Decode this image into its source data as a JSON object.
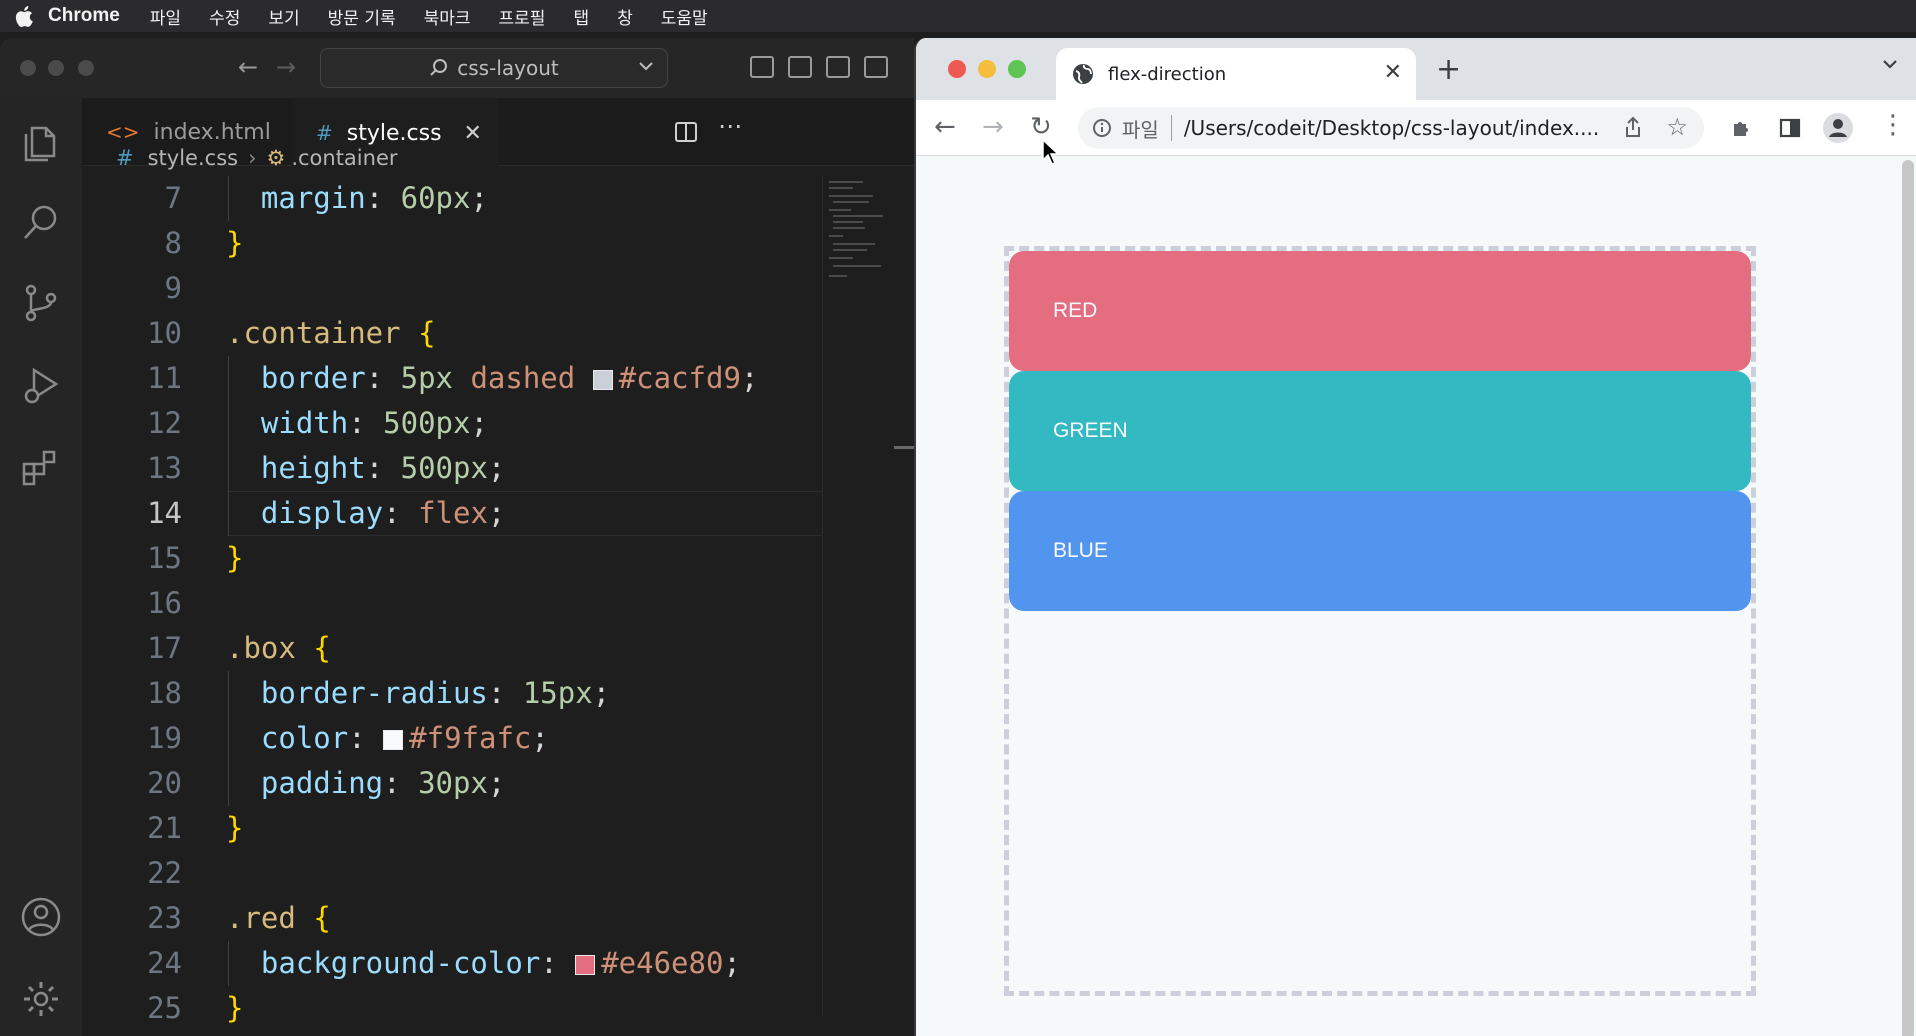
{
  "menubar": {
    "app_name": "Chrome",
    "items": [
      "파일",
      "수정",
      "보기",
      "방문 기록",
      "북마크",
      "프로필",
      "탭",
      "창",
      "도움말"
    ]
  },
  "vscode": {
    "search_text": "css-layout",
    "tabs": [
      {
        "icon": "<>",
        "label": "index.html",
        "active": false
      },
      {
        "icon": "#",
        "label": "style.css",
        "active": true
      }
    ],
    "breadcrumb": {
      "file": "style.css",
      "symbol": ".container"
    },
    "lines": [
      {
        "n": "7",
        "active": false,
        "tokens": [
          [
            "  ",
            "punc"
          ],
          [
            "margin",
            "prop"
          ],
          [
            ": ",
            "punc"
          ],
          [
            "60px",
            "num"
          ],
          [
            ";",
            "punc"
          ]
        ]
      },
      {
        "n": "8",
        "active": false,
        "tokens": [
          [
            "}",
            "brace"
          ]
        ]
      },
      {
        "n": "9",
        "active": false,
        "tokens": []
      },
      {
        "n": "10",
        "active": false,
        "tokens": [
          [
            ".container",
            "sel"
          ],
          [
            " ",
            "punc"
          ],
          [
            "{",
            "brace"
          ]
        ]
      },
      {
        "n": "11",
        "active": false,
        "tokens": [
          [
            "  ",
            "punc"
          ],
          [
            "border",
            "prop"
          ],
          [
            ": ",
            "punc"
          ],
          [
            "5px",
            "num"
          ],
          [
            " ",
            "punc"
          ],
          [
            "dashed",
            "str"
          ],
          [
            " ",
            "punc"
          ],
          [
            "#cacfd9",
            "swatch-str"
          ],
          [
            ";",
            "punc"
          ]
        ]
      },
      {
        "n": "12",
        "active": false,
        "tokens": [
          [
            "  ",
            "punc"
          ],
          [
            "width",
            "prop"
          ],
          [
            ": ",
            "punc"
          ],
          [
            "500px",
            "num"
          ],
          [
            ";",
            "punc"
          ]
        ]
      },
      {
        "n": "13",
        "active": false,
        "tokens": [
          [
            "  ",
            "punc"
          ],
          [
            "height",
            "prop"
          ],
          [
            ": ",
            "punc"
          ],
          [
            "500px",
            "num"
          ],
          [
            ";",
            "punc"
          ]
        ]
      },
      {
        "n": "14",
        "active": true,
        "tokens": [
          [
            "  ",
            "punc"
          ],
          [
            "display",
            "prop"
          ],
          [
            ": ",
            "punc"
          ],
          [
            "flex",
            "str"
          ],
          [
            ";",
            "punc"
          ]
        ]
      },
      {
        "n": "15",
        "active": false,
        "tokens": [
          [
            "}",
            "brace"
          ]
        ]
      },
      {
        "n": "16",
        "active": false,
        "tokens": []
      },
      {
        "n": "17",
        "active": false,
        "tokens": [
          [
            ".box",
            "sel"
          ],
          [
            " ",
            "punc"
          ],
          [
            "{",
            "brace"
          ]
        ]
      },
      {
        "n": "18",
        "active": false,
        "tokens": [
          [
            "  ",
            "punc"
          ],
          [
            "border-radius",
            "prop"
          ],
          [
            ": ",
            "punc"
          ],
          [
            "15px",
            "num"
          ],
          [
            ";",
            "punc"
          ]
        ]
      },
      {
        "n": "19",
        "active": false,
        "tokens": [
          [
            "  ",
            "punc"
          ],
          [
            "color",
            "prop"
          ],
          [
            ": ",
            "punc"
          ],
          [
            "#f9fafc",
            "swatch-str"
          ],
          [
            ";",
            "punc"
          ]
        ]
      },
      {
        "n": "20",
        "active": false,
        "tokens": [
          [
            "  ",
            "punc"
          ],
          [
            "padding",
            "prop"
          ],
          [
            ": ",
            "punc"
          ],
          [
            "30px",
            "num"
          ],
          [
            ";",
            "punc"
          ]
        ]
      },
      {
        "n": "21",
        "active": false,
        "tokens": [
          [
            "}",
            "brace"
          ]
        ]
      },
      {
        "n": "22",
        "active": false,
        "tokens": []
      },
      {
        "n": "23",
        "active": false,
        "tokens": [
          [
            ".red",
            "sel"
          ],
          [
            " ",
            "punc"
          ],
          [
            "{",
            "brace"
          ]
        ]
      },
      {
        "n": "24",
        "active": false,
        "tokens": [
          [
            "  ",
            "punc"
          ],
          [
            "background-color",
            "prop"
          ],
          [
            ": ",
            "punc"
          ],
          [
            "#e46e80",
            "swatch-str"
          ],
          [
            ";",
            "punc"
          ]
        ]
      },
      {
        "n": "25",
        "active": false,
        "tokens": [
          [
            "}",
            "brace"
          ]
        ]
      }
    ]
  },
  "chrome": {
    "tab_title": "flex-direction",
    "omnibox_scheme": "파일",
    "url": "/Users/codeit/Desktop/css-layout/index....",
    "boxes": [
      {
        "label": "RED",
        "class": "red",
        "color": "#e46e80"
      },
      {
        "label": "GREEN",
        "class": "green",
        "color": "#32b9c1"
      },
      {
        "label": "BLUE",
        "class": "blue",
        "color": "#5195ee"
      }
    ],
    "container_border_color": "#cacfd9"
  }
}
